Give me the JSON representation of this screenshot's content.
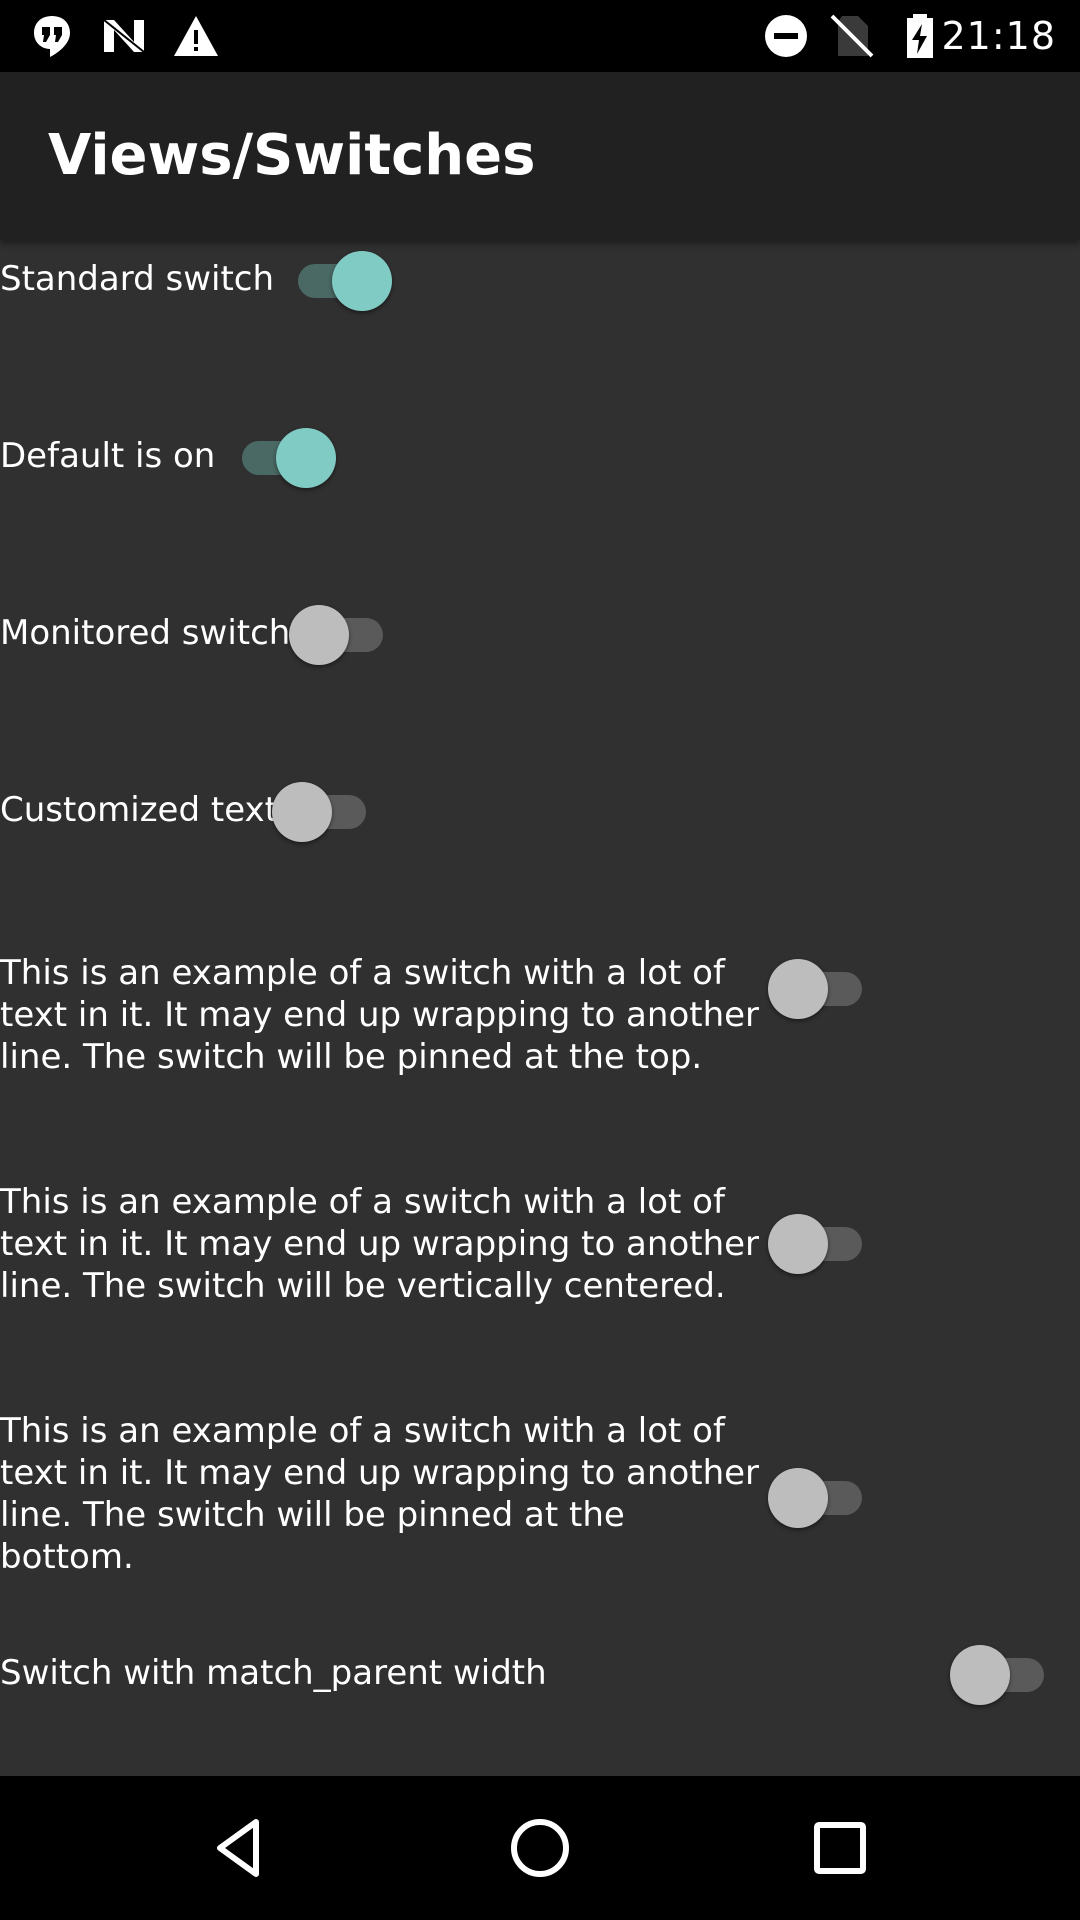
{
  "status_bar": {
    "time": "21:18",
    "icons_left": [
      "hangouts-icon",
      "n-icon",
      "warning-icon"
    ],
    "icons_right": [
      "do-not-disturb-icon",
      "no-sim-icon",
      "battery-charging-icon"
    ]
  },
  "toolbar": {
    "title": "Views/Switches"
  },
  "switches": [
    {
      "label": "Standard switch",
      "checked": true
    },
    {
      "label": "Default is on",
      "checked": true
    },
    {
      "label": "Monitored switch",
      "checked": false
    },
    {
      "label": "Customized text",
      "checked": false
    },
    {
      "label": "This is an example of a switch with a lot of text in it. It may end up wrapping to another line. The switch will be pinned at the top.",
      "checked": false
    },
    {
      "label": "This is an example of a switch with a lot of text in it. It may end up wrapping to another line. The switch will be vertically centered.",
      "checked": false
    },
    {
      "label": "This is an example of a switch with a lot of text in it. It may end up wrapping to another line. The switch will be pinned at the bottom.",
      "checked": false
    },
    {
      "label": "Switch with match_parent width",
      "checked": false
    }
  ],
  "colors": {
    "accent": "#80cbc4",
    "background": "#303030",
    "toolbar": "#212121"
  },
  "nav_bar": {
    "buttons": [
      "back-icon",
      "home-icon",
      "recents-icon"
    ]
  }
}
